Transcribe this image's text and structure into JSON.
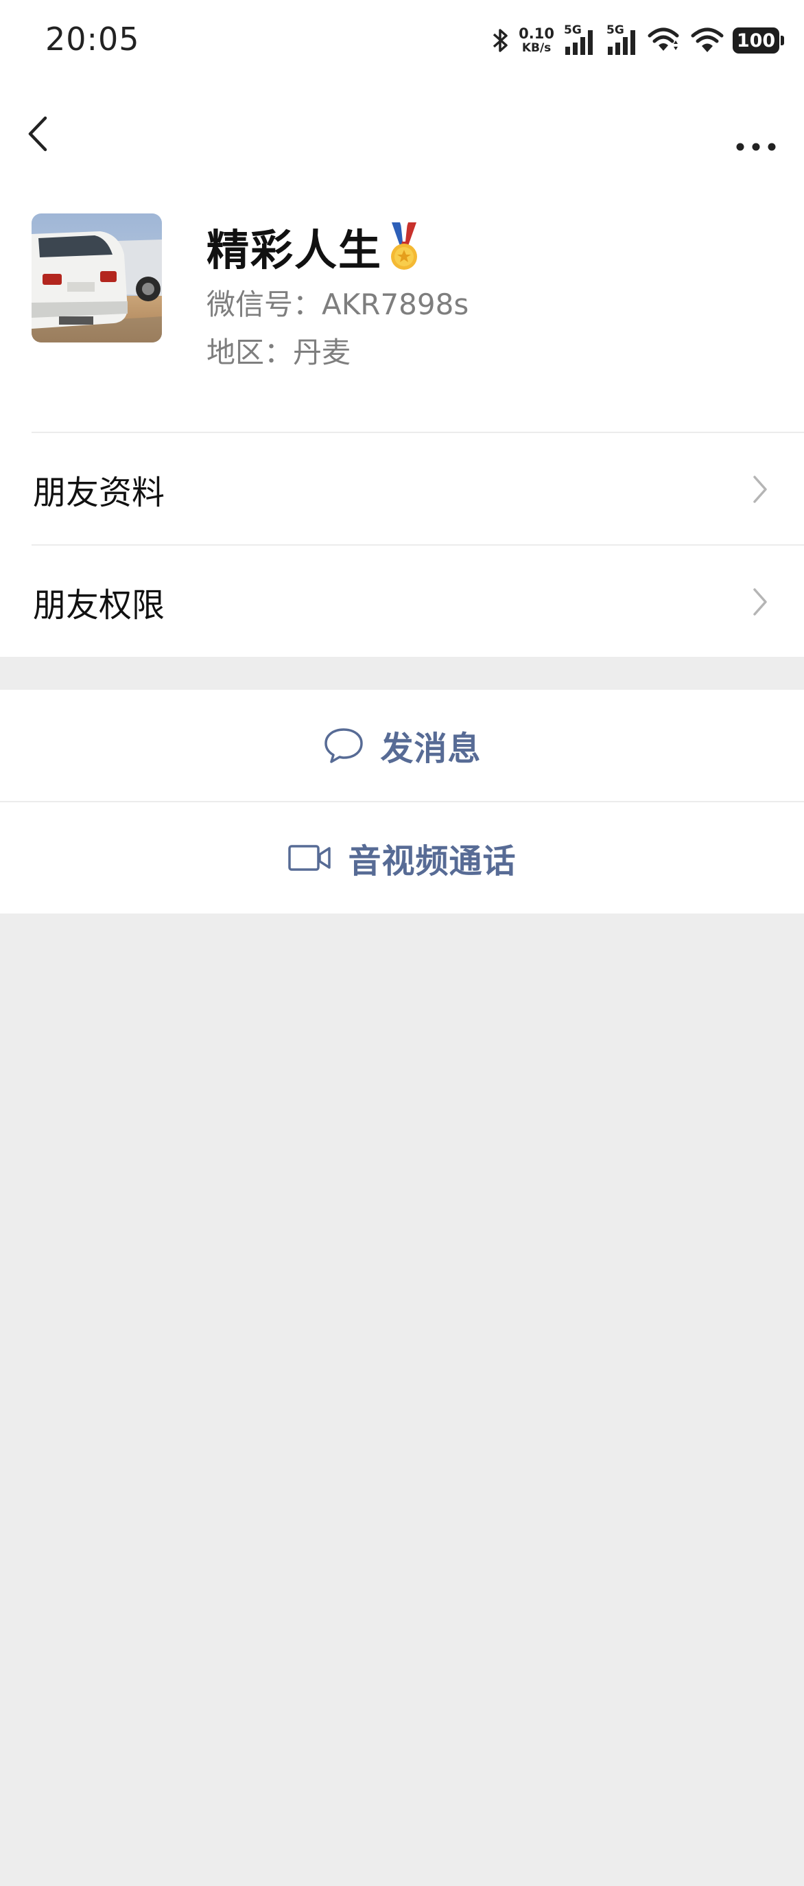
{
  "status_bar": {
    "time": "20:05",
    "net_speed_value": "0.10",
    "net_speed_unit": "KB/s",
    "signal1_tag": "5G",
    "signal2_tag": "5G",
    "battery": "100",
    "icons": [
      "bluetooth-icon",
      "signal-icon",
      "signal-icon",
      "wifi-icon",
      "wifi-icon",
      "battery-icon"
    ]
  },
  "nav": {
    "back_icon": "chevron-left-icon",
    "more_icon": "more-dots-icon"
  },
  "profile": {
    "name": "精彩人生",
    "medal_icon": "medal-icon",
    "wechat_id": "微信号：AKR7898s",
    "region": "地区：丹麦"
  },
  "menu": {
    "items": [
      {
        "label": "朋友资料"
      },
      {
        "label": "朋友权限"
      }
    ]
  },
  "actions": {
    "message_label": "发消息",
    "call_label": "音视频通话"
  },
  "colors": {
    "accent": "#576b95",
    "background": "#ededed",
    "surface": "#ffffff",
    "secondary_text": "#7e7e7e"
  }
}
